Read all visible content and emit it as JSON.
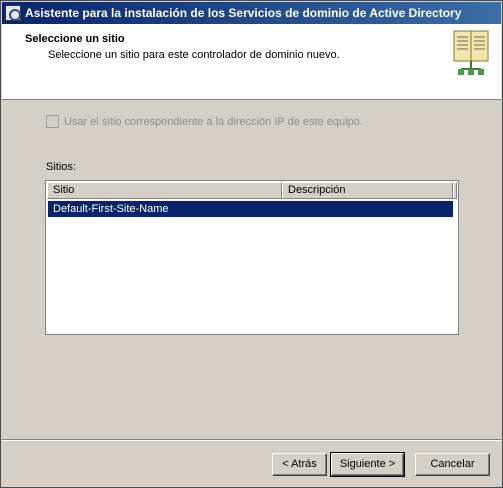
{
  "window": {
    "title": "Asistente para la instalación de los Servicios de dominio de Active Directory"
  },
  "header": {
    "title": "Seleccione un sitio",
    "subtitle": "Seleccione un sitio para este controlador de dominio nuevo.",
    "icon": "book-icon"
  },
  "options": {
    "use_ip_site_label": "Usar el sitio correspondiente a la dirección IP de este equipo.",
    "use_ip_site_checked": false,
    "use_ip_site_enabled": false
  },
  "sites": {
    "label": "Sitios:",
    "columns": [
      "Sitio",
      "Descripción"
    ],
    "rows": [
      {
        "site": "Default-First-Site-Name",
        "description": ""
      }
    ],
    "selected_index": 0
  },
  "buttons": {
    "back": "< Atrás",
    "next": "Siguiente >",
    "cancel": "Cancelar"
  },
  "colors": {
    "titlebar_start": "#0a246a",
    "titlebar_end": "#3a6ea5",
    "selection": "#0a246a",
    "dialog_bg": "#d4d0c8"
  }
}
